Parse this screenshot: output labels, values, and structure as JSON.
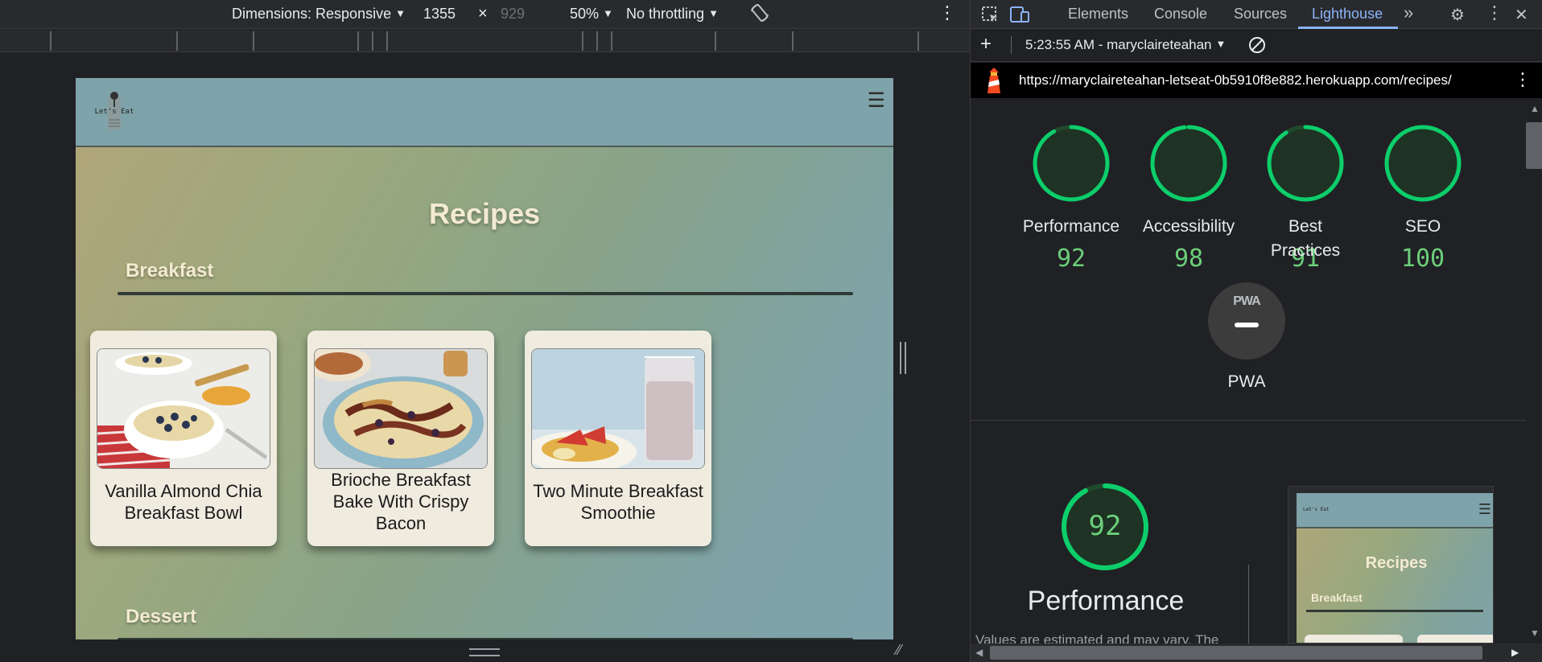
{
  "device_toolbar": {
    "dimensions_label": "Dimensions: Responsive",
    "width": "1355",
    "times": "×",
    "height": "929",
    "zoom": "50%",
    "throttling": "No throttling"
  },
  "site": {
    "logo_text": "Let's Eat",
    "page_title": "Recipes",
    "categories": [
      {
        "name": "Breakfast"
      },
      {
        "name": "Dessert"
      }
    ],
    "recipes": [
      {
        "title": "Vanilla Almond Chia Breakfast Bowl"
      },
      {
        "title": "Brioche Breakfast Bake With Crispy Bacon"
      },
      {
        "title": "Two Minute Breakfast Smoothie"
      }
    ]
  },
  "devtools": {
    "tabs": [
      "Elements",
      "Console",
      "Sources",
      "Lighthouse"
    ],
    "active_tab": "Lighthouse",
    "report_selector": "5:23:55 AM - maryclaireteahan",
    "url": "https://maryclaireteahan-letseat-0b5910f8e882.herokuapp.com/recipes/",
    "scores": [
      {
        "label": "Performance",
        "value": "92",
        "score": 92
      },
      {
        "label": "Accessibility",
        "value": "98",
        "score": 98
      },
      {
        "label": "Best Practices",
        "label_lines": [
          "Best",
          "Practices"
        ],
        "value": "91",
        "score": 91
      },
      {
        "label": "SEO",
        "value": "100",
        "score": 100
      }
    ],
    "pwa_label": "PWA",
    "pwa_badge": "PWA",
    "performance_detail": {
      "score": "92",
      "title": "Performance",
      "note": "Values are estimated and may vary. The"
    },
    "thumbnail": {
      "logo_text": "Let's Eat",
      "title": "Recipes",
      "category": "Breakfast"
    },
    "colors": {
      "pass": "#0cce6b",
      "pass_text": "#6bcf7a",
      "accent": "#8ab4f8"
    }
  }
}
